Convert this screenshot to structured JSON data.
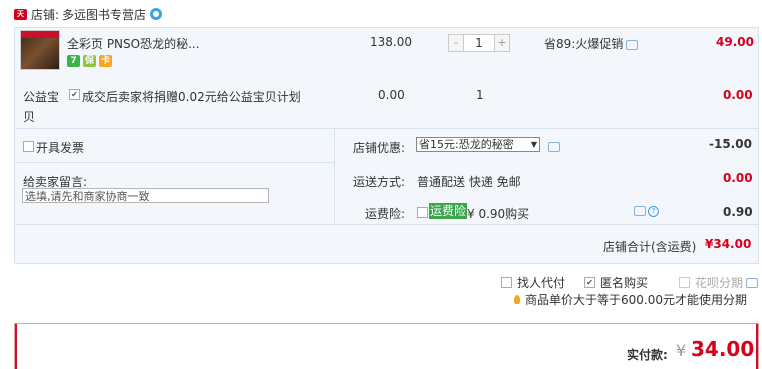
{
  "shop": {
    "badge": "天猫",
    "label": "店铺:",
    "name": "多远图书专营店"
  },
  "item": {
    "title": "全彩页 PNSO恐龙的秘...",
    "badges": [
      "7",
      "保",
      "卡"
    ],
    "price": "138.00",
    "qty_minus": "-",
    "qty": "1",
    "qty_plus": "+",
    "promo": "省89:火爆促销",
    "subtotal": "49.00"
  },
  "charity": {
    "label": "公益宝贝",
    "text": "成交后卖家将捐赠0.02元给公益宝贝计划",
    "price": "0.00",
    "qty": "1",
    "subtotal": "0.00"
  },
  "invoice": {
    "label": "开具发票"
  },
  "message": {
    "label": "给卖家留言:",
    "value": "选填,请先和商家协商一致"
  },
  "discount": {
    "label": "店铺优惠:",
    "selected": "省15元:恐龙的秘密",
    "value": "-15.00"
  },
  "shipping": {
    "label": "运送方式:",
    "value": "普通配送 快递 免邮",
    "price": "0.00"
  },
  "insurance": {
    "label": "运费险:",
    "tag": "运费险",
    "price_text": "¥ 0.90购买",
    "value": "0.90"
  },
  "shop_total": {
    "label": "店铺合计(含运费)",
    "value": "¥34.00"
  },
  "options": {
    "proxy_pay": "找人代付",
    "anonymous": "匿名购买",
    "huabei": "花呗分期",
    "huabei_note": "商品单价大于等于600.00元才能使用分期"
  },
  "payment": {
    "label": "实付款:",
    "currency": "¥",
    "amount": "34.00"
  },
  "colors": {
    "price_red": "#d6001c",
    "panel_bg": "#f3f7fc",
    "border": "#d7e3ef",
    "insurance_green": "#3aa54a"
  }
}
